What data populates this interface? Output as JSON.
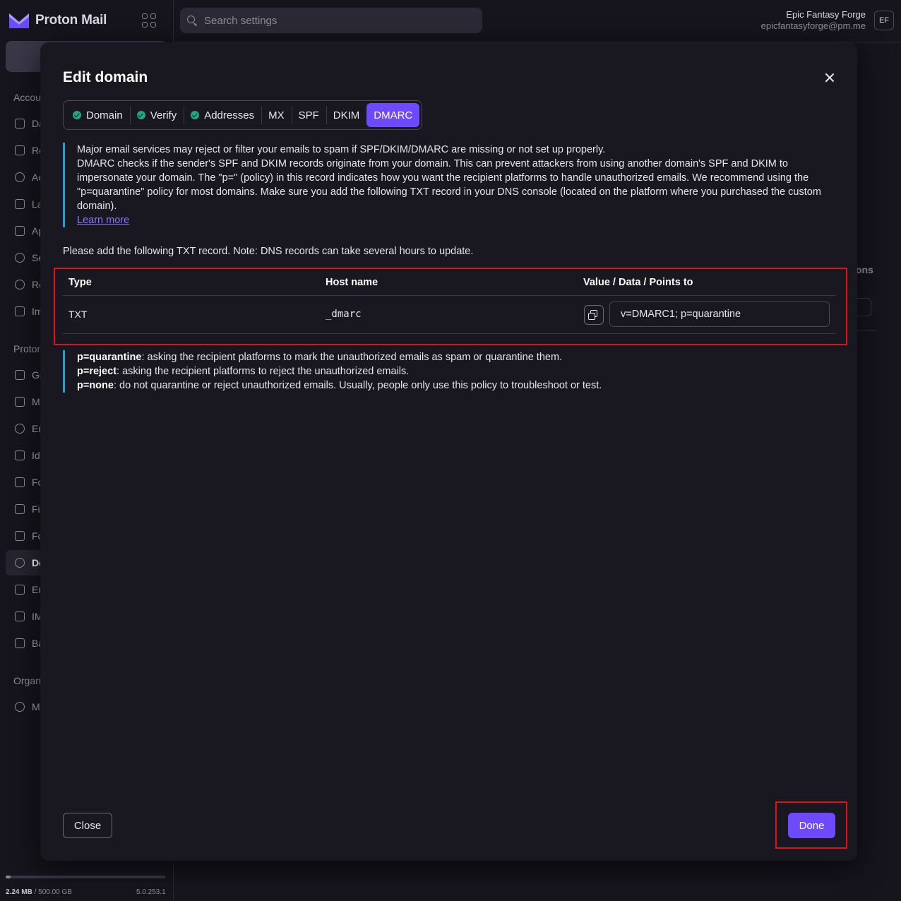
{
  "app": {
    "name": "Proton Mail"
  },
  "search": {
    "placeholder": "Search settings"
  },
  "user": {
    "name": "Epic Fantasy Forge",
    "email": "epicfantasyforge@pm.me",
    "initials": "EF"
  },
  "sidebar": {
    "sections": [
      "Accou",
      "Proton",
      "Organ"
    ],
    "items": [
      "Da",
      "Re",
      "Ac",
      "La",
      "Ap",
      "Se",
      "Re",
      "Im",
      "Go",
      "Me",
      "En",
      "Id",
      "Fo",
      "Fi",
      "Fo",
      "Do",
      "En",
      "IM",
      "Ba",
      "Mu"
    ]
  },
  "storage": {
    "used": "2.24 MB",
    "total": "/ 500.00 GB",
    "fraction": 0.03,
    "version": "5.0.253.1"
  },
  "background": {
    "partial_text": "ons"
  },
  "modal": {
    "title": "Edit domain",
    "tabs": [
      {
        "label": "Domain",
        "done": true
      },
      {
        "label": "Verify",
        "done": true
      },
      {
        "label": "Addresses",
        "done": true
      },
      {
        "label": "MX",
        "done": false
      },
      {
        "label": "SPF",
        "done": false
      },
      {
        "label": "DKIM",
        "done": false
      },
      {
        "label": "DMARC",
        "done": false,
        "active": true
      }
    ],
    "info_line1": "Major email services may reject or filter your emails to spam if SPF/DKIM/DMARC are missing or not set up properly.",
    "info_line2": "DMARC checks if the sender's SPF and DKIM records originate from your domain. This can prevent attackers from using another domain's SPF and DKIM to impersonate your domain. The \"p=\" (policy) in this record indicates how you want the recipient platforms to handle unauthorized emails. We recommend using the \"p=quarantine\" policy for most domains. Make sure you add the following TXT record in your DNS console (located on the platform where you purchased the custom domain).",
    "learn_more": "Learn more",
    "note": "Please add the following TXT record. Note: DNS records can take several hours to update.",
    "table": {
      "headers": [
        "Type",
        "Host name",
        "Value / Data / Points to"
      ],
      "row": {
        "type": "TXT",
        "host": "_dmarc",
        "value": "v=DMARC1; p=quarantine"
      }
    },
    "policies": [
      {
        "key": "p=quarantine",
        "text": ": asking the recipient platforms to mark the unauthorized emails as spam or quarantine them."
      },
      {
        "key": "p=reject",
        "text": ": asking the recipient platforms to reject the unauthorized emails."
      },
      {
        "key": "p=none",
        "text": ": do not quarantine or reject unauthorized emails. Usually, people only use this policy to troubleshoot or test."
      }
    ],
    "close_label": "Close",
    "done_label": "Done"
  },
  "colors": {
    "accent": "#6d4aff",
    "success": "#1ea885",
    "info_border": "#239ece",
    "highlight": "#e0121e",
    "link": "#8e75ff"
  }
}
